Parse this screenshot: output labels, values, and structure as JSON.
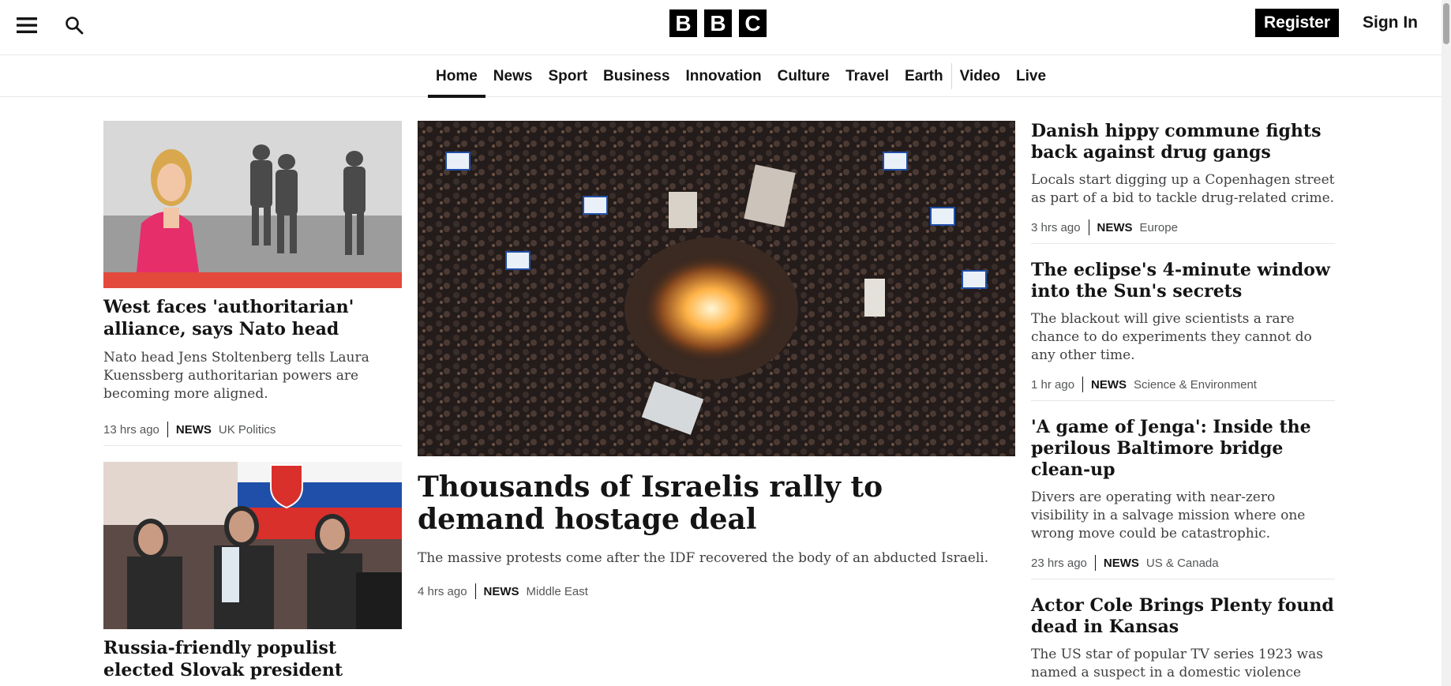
{
  "header": {
    "logo_letters": [
      "B",
      "B",
      "C"
    ],
    "register_label": "Register",
    "signin_label": "Sign In"
  },
  "nav": {
    "items": [
      "Home",
      "News",
      "Sport",
      "Business",
      "Innovation",
      "Culture",
      "Travel",
      "Earth",
      "Video",
      "Live"
    ],
    "active": "Home"
  },
  "left": {
    "story1": {
      "headline": "West faces 'authoritarian' alliance, says Nato head",
      "summary": "Nato head Jens Stoltenberg tells Laura Kuenssberg authoritarian powers are becoming more aligned.",
      "time": "13 hrs ago",
      "brand": "NEWS",
      "section": "UK Politics"
    },
    "story2": {
      "headline": "Russia-friendly populist elected Slovak president"
    }
  },
  "main": {
    "headline": "Thousands of Israelis rally to demand hostage deal",
    "summary": "The massive protests come after the IDF recovered the body of an abducted Israeli.",
    "time": "4 hrs ago",
    "brand": "NEWS",
    "section": "Middle East"
  },
  "right": {
    "stories": [
      {
        "headline": "Danish hippy commune fights back against drug gangs",
        "summary": "Locals start digging up a Copenhagen street as part of a bid to tackle drug-related crime.",
        "time": "3 hrs ago",
        "brand": "NEWS",
        "section": "Europe"
      },
      {
        "headline": "The eclipse's 4-minute window into the Sun's secrets",
        "summary": "The blackout will give scientists a rare chance to do experiments they cannot do any other time.",
        "time": "1 hr ago",
        "brand": "NEWS",
        "section": "Science & Environment"
      },
      {
        "headline": "'A game of Jenga': Inside the perilous Baltimore bridge clean-up",
        "summary": "Divers are operating with near-zero visibility in a salvage mission where one wrong move could be catastrophic.",
        "time": "23 hrs ago",
        "brand": "NEWS",
        "section": "US & Canada"
      },
      {
        "headline": "Actor Cole Brings Plenty found dead in Kansas",
        "summary": "The US star of popular TV series 1923 was named a suspect in a domestic violence"
      }
    ]
  },
  "colors": {
    "text": "#141414",
    "muted": "#545658",
    "brand_black": "#000000",
    "divider": "#e6e6e6",
    "accent_red": "#e34a3b"
  },
  "icons": [
    "menu-icon",
    "search-icon"
  ]
}
